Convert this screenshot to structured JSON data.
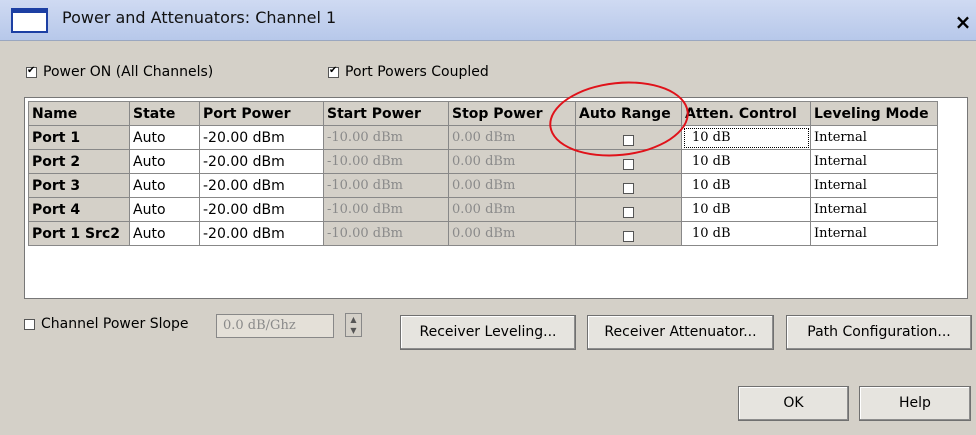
{
  "window": {
    "title": "Power and Attenuators: Channel 1",
    "close_label": "×"
  },
  "options": {
    "power_on": {
      "checked": true,
      "label": "Power ON (All Channels)"
    },
    "port_powers_coupled": {
      "checked": true,
      "label": "Port Powers Coupled"
    }
  },
  "table": {
    "headers": [
      "Name",
      "State",
      "Port Power",
      "Start Power",
      "Stop Power",
      "Auto Range",
      "Atten. Control",
      "Leveling Mode"
    ],
    "rows": [
      {
        "name": "Port 1",
        "state": "Auto",
        "port_power": "-20.00 dBm",
        "start_power": "-10.00 dBm",
        "stop_power": "0.00 dBm",
        "auto_range": false,
        "atten": "10 dB",
        "leveling": "Internal"
      },
      {
        "name": "Port 2",
        "state": "Auto",
        "port_power": "-20.00 dBm",
        "start_power": "-10.00 dBm",
        "stop_power": "0.00 dBm",
        "auto_range": false,
        "atten": "10 dB",
        "leveling": "Internal"
      },
      {
        "name": "Port 3",
        "state": "Auto",
        "port_power": "-20.00 dBm",
        "start_power": "-10.00 dBm",
        "stop_power": "0.00 dBm",
        "auto_range": false,
        "atten": "10 dB",
        "leveling": "Internal"
      },
      {
        "name": "Port 4",
        "state": "Auto",
        "port_power": "-20.00 dBm",
        "start_power": "-10.00 dBm",
        "stop_power": "0.00 dBm",
        "auto_range": false,
        "atten": "10 dB",
        "leveling": "Internal"
      },
      {
        "name": "Port 1 Src2",
        "state": "Auto",
        "port_power": "-20.00 dBm",
        "start_power": "-10.00 dBm",
        "stop_power": "0.00 dBm",
        "auto_range": false,
        "atten": "10 dB",
        "leveling": "Internal"
      }
    ]
  },
  "slope": {
    "checked": false,
    "label": "Channel Power Slope",
    "value": "0.0 dB/Ghz"
  },
  "buttons": {
    "receiver_leveling": "Receiver Leveling...",
    "receiver_attenuator": "Receiver Attenuator...",
    "path_configuration": "Path Configuration...",
    "ok": "OK",
    "help": "Help"
  },
  "annotation_color": "#e0121a"
}
